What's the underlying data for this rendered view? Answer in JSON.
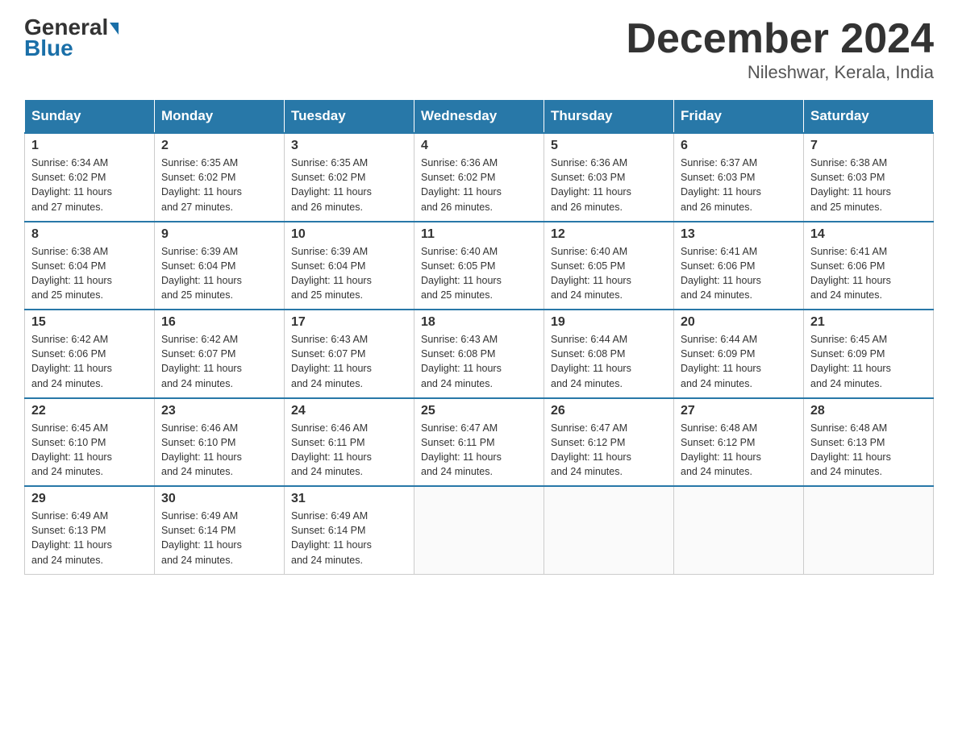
{
  "header": {
    "logo_general": "General",
    "logo_blue": "Blue",
    "month_title": "December 2024",
    "location": "Nileshwar, Kerala, India"
  },
  "days_of_week": [
    "Sunday",
    "Monday",
    "Tuesday",
    "Wednesday",
    "Thursday",
    "Friday",
    "Saturday"
  ],
  "weeks": [
    [
      {
        "day": "1",
        "sunrise": "6:34 AM",
        "sunset": "6:02 PM",
        "daylight": "11 hours and 27 minutes."
      },
      {
        "day": "2",
        "sunrise": "6:35 AM",
        "sunset": "6:02 PM",
        "daylight": "11 hours and 27 minutes."
      },
      {
        "day": "3",
        "sunrise": "6:35 AM",
        "sunset": "6:02 PM",
        "daylight": "11 hours and 26 minutes."
      },
      {
        "day": "4",
        "sunrise": "6:36 AM",
        "sunset": "6:02 PM",
        "daylight": "11 hours and 26 minutes."
      },
      {
        "day": "5",
        "sunrise": "6:36 AM",
        "sunset": "6:03 PM",
        "daylight": "11 hours and 26 minutes."
      },
      {
        "day": "6",
        "sunrise": "6:37 AM",
        "sunset": "6:03 PM",
        "daylight": "11 hours and 26 minutes."
      },
      {
        "day": "7",
        "sunrise": "6:38 AM",
        "sunset": "6:03 PM",
        "daylight": "11 hours and 25 minutes."
      }
    ],
    [
      {
        "day": "8",
        "sunrise": "6:38 AM",
        "sunset": "6:04 PM",
        "daylight": "11 hours and 25 minutes."
      },
      {
        "day": "9",
        "sunrise": "6:39 AM",
        "sunset": "6:04 PM",
        "daylight": "11 hours and 25 minutes."
      },
      {
        "day": "10",
        "sunrise": "6:39 AM",
        "sunset": "6:04 PM",
        "daylight": "11 hours and 25 minutes."
      },
      {
        "day": "11",
        "sunrise": "6:40 AM",
        "sunset": "6:05 PM",
        "daylight": "11 hours and 25 minutes."
      },
      {
        "day": "12",
        "sunrise": "6:40 AM",
        "sunset": "6:05 PM",
        "daylight": "11 hours and 24 minutes."
      },
      {
        "day": "13",
        "sunrise": "6:41 AM",
        "sunset": "6:06 PM",
        "daylight": "11 hours and 24 minutes."
      },
      {
        "day": "14",
        "sunrise": "6:41 AM",
        "sunset": "6:06 PM",
        "daylight": "11 hours and 24 minutes."
      }
    ],
    [
      {
        "day": "15",
        "sunrise": "6:42 AM",
        "sunset": "6:06 PM",
        "daylight": "11 hours and 24 minutes."
      },
      {
        "day": "16",
        "sunrise": "6:42 AM",
        "sunset": "6:07 PM",
        "daylight": "11 hours and 24 minutes."
      },
      {
        "day": "17",
        "sunrise": "6:43 AM",
        "sunset": "6:07 PM",
        "daylight": "11 hours and 24 minutes."
      },
      {
        "day": "18",
        "sunrise": "6:43 AM",
        "sunset": "6:08 PM",
        "daylight": "11 hours and 24 minutes."
      },
      {
        "day": "19",
        "sunrise": "6:44 AM",
        "sunset": "6:08 PM",
        "daylight": "11 hours and 24 minutes."
      },
      {
        "day": "20",
        "sunrise": "6:44 AM",
        "sunset": "6:09 PM",
        "daylight": "11 hours and 24 minutes."
      },
      {
        "day": "21",
        "sunrise": "6:45 AM",
        "sunset": "6:09 PM",
        "daylight": "11 hours and 24 minutes."
      }
    ],
    [
      {
        "day": "22",
        "sunrise": "6:45 AM",
        "sunset": "6:10 PM",
        "daylight": "11 hours and 24 minutes."
      },
      {
        "day": "23",
        "sunrise": "6:46 AM",
        "sunset": "6:10 PM",
        "daylight": "11 hours and 24 minutes."
      },
      {
        "day": "24",
        "sunrise": "6:46 AM",
        "sunset": "6:11 PM",
        "daylight": "11 hours and 24 minutes."
      },
      {
        "day": "25",
        "sunrise": "6:47 AM",
        "sunset": "6:11 PM",
        "daylight": "11 hours and 24 minutes."
      },
      {
        "day": "26",
        "sunrise": "6:47 AM",
        "sunset": "6:12 PM",
        "daylight": "11 hours and 24 minutes."
      },
      {
        "day": "27",
        "sunrise": "6:48 AM",
        "sunset": "6:12 PM",
        "daylight": "11 hours and 24 minutes."
      },
      {
        "day": "28",
        "sunrise": "6:48 AM",
        "sunset": "6:13 PM",
        "daylight": "11 hours and 24 minutes."
      }
    ],
    [
      {
        "day": "29",
        "sunrise": "6:49 AM",
        "sunset": "6:13 PM",
        "daylight": "11 hours and 24 minutes."
      },
      {
        "day": "30",
        "sunrise": "6:49 AM",
        "sunset": "6:14 PM",
        "daylight": "11 hours and 24 minutes."
      },
      {
        "day": "31",
        "sunrise": "6:49 AM",
        "sunset": "6:14 PM",
        "daylight": "11 hours and 24 minutes."
      },
      null,
      null,
      null,
      null
    ]
  ],
  "labels": {
    "sunrise": "Sunrise:",
    "sunset": "Sunset:",
    "daylight": "Daylight:"
  }
}
